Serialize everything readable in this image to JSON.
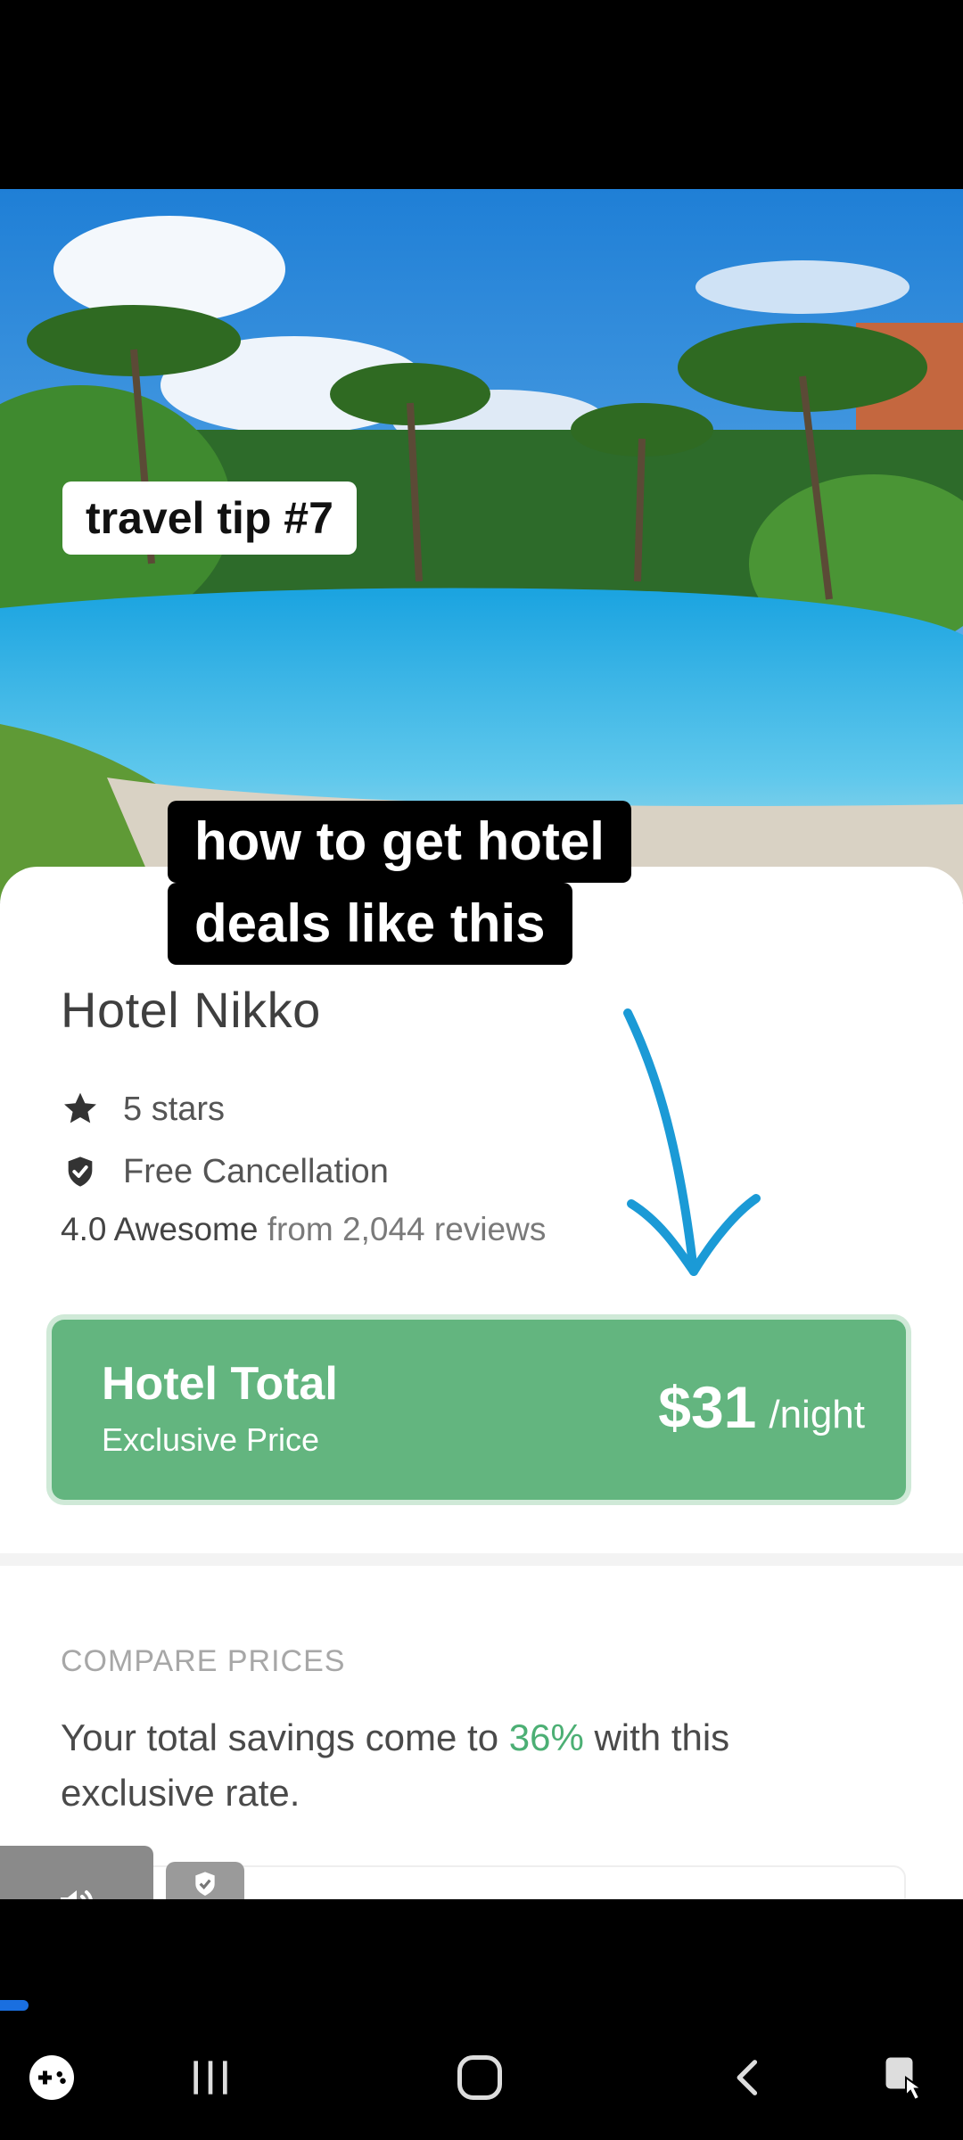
{
  "overlay_captions": {
    "tip": "travel tip #7",
    "headline_line1": "how to get hotel",
    "headline_line2": "deals like this"
  },
  "hotel": {
    "name": "Hotel Nikko",
    "stars_label": "5 stars",
    "cancellation_label": "Free Cancellation",
    "rating_score": "4.0 Awesome",
    "rating_suffix": "from 2,044 reviews"
  },
  "total": {
    "title": "Hotel Total",
    "subtitle": "Exclusive Price",
    "price": "$31",
    "unit": "/night"
  },
  "compare": {
    "heading": "COMPARE PRICES",
    "savings_prefix": "Your total savings come to",
    "savings_pct": "36%",
    "savings_suffix": "with this exclusive rate."
  },
  "video_progress": 0.03,
  "colors": {
    "accent_green": "#63b57f",
    "arrow_blue": "#1b9ad6",
    "progress_blue": "#1a6fe0"
  },
  "icons": [
    "star-icon",
    "shield-check-icon",
    "volume-icon",
    "donate-icon",
    "game-controller-icon",
    "recent-apps-icon",
    "home-icon",
    "back-icon",
    "accessibility-icon"
  ]
}
